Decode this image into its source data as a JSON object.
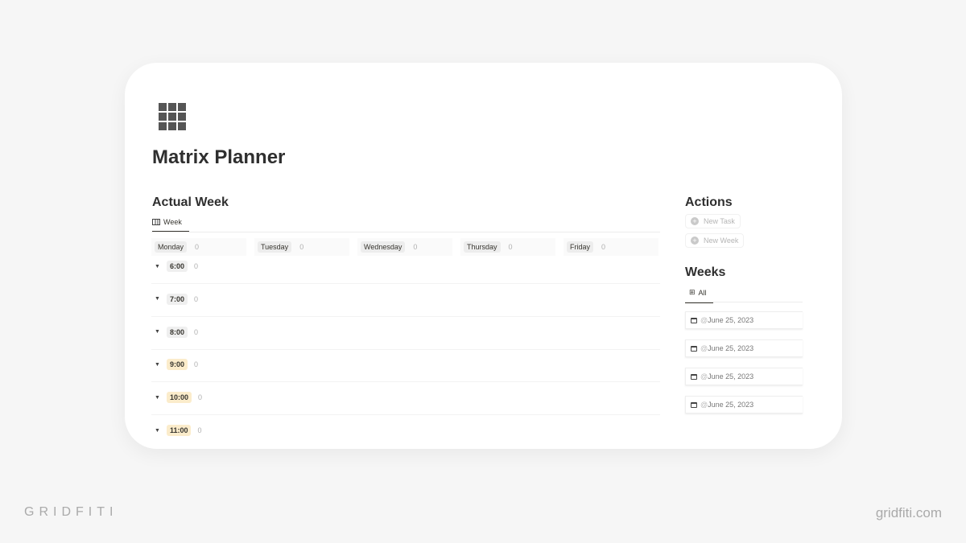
{
  "page": {
    "title": "Matrix Planner",
    "icon": "grid-icon"
  },
  "actual_week": {
    "heading": "Actual Week",
    "tab": "Week",
    "days": [
      {
        "label": "Monday",
        "count": "0"
      },
      {
        "label": "Tuesday",
        "count": "0"
      },
      {
        "label": "Wednesday",
        "count": "0"
      },
      {
        "label": "Thursday",
        "count": "0"
      },
      {
        "label": "Friday",
        "count": "0"
      }
    ],
    "times": [
      {
        "label": "6:00",
        "count": "0",
        "highlight": false
      },
      {
        "label": "7:00",
        "count": "0",
        "highlight": false
      },
      {
        "label": "8:00",
        "count": "0",
        "highlight": false
      },
      {
        "label": "9:00",
        "count": "0",
        "highlight": true
      },
      {
        "label": "10:00",
        "count": "0",
        "highlight": true
      },
      {
        "label": "11:00",
        "count": "0",
        "highlight": true
      }
    ]
  },
  "actions": {
    "heading": "Actions",
    "buttons": [
      "New Task",
      "New Week"
    ]
  },
  "weeks": {
    "heading": "Weeks",
    "tab": "All",
    "items": [
      "June 25, 2023",
      "June 25, 2023",
      "June 25, 2023",
      "June 25, 2023"
    ],
    "prefix": "@"
  },
  "branding": {
    "left": "GRIDFITI",
    "right": "gridfiti.com"
  },
  "colors": {
    "highlight": "#fbeccb",
    "background": "#f6f6f6"
  }
}
